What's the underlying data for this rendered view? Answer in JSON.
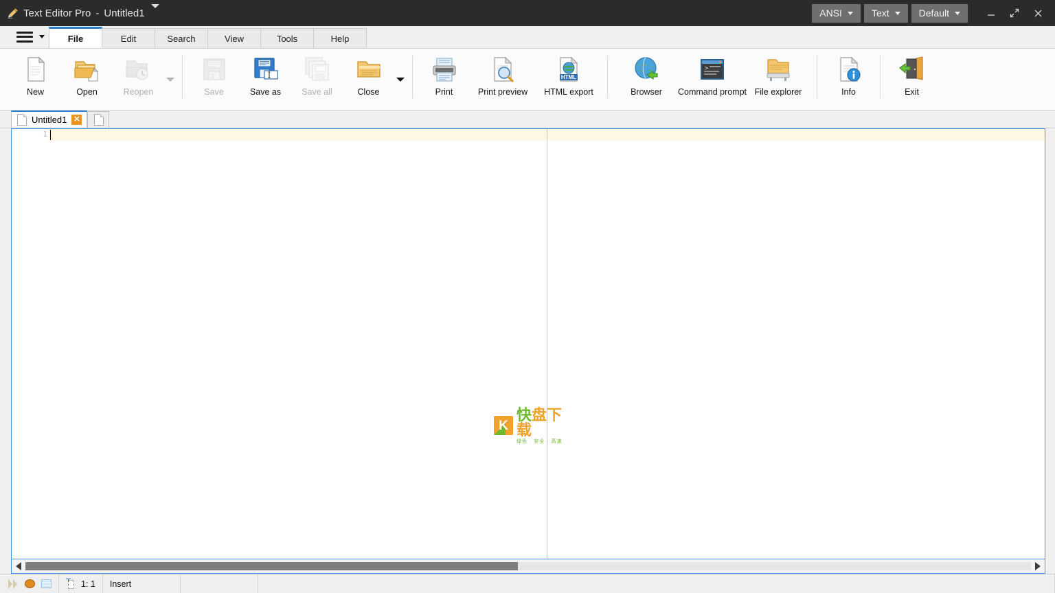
{
  "window": {
    "app_title": "Text Editor Pro",
    "separator": "-",
    "document_title": "Untitled1",
    "app_icon": "pencil-icon",
    "title_dropdown_icon": "chevron-down-icon",
    "encoding_button": "ANSI",
    "filetype_button": "Text",
    "scheme_button": "Default",
    "minimize_icon": "minimize-icon",
    "maximize_icon": "maximize-restore-icon",
    "close_icon": "close-icon",
    "titlebar_bg": "#2b2b2b",
    "accent": "#2b7fd4"
  },
  "menu": {
    "hamburger_icon": "hamburger-menu-icon",
    "hamburger_caret_icon": "chevron-down-icon",
    "tabs": [
      {
        "label": "File",
        "active": true
      },
      {
        "label": "Edit",
        "active": false
      },
      {
        "label": "Search",
        "active": false
      },
      {
        "label": "View",
        "active": false
      },
      {
        "label": "Tools",
        "active": false
      },
      {
        "label": "Help",
        "active": false
      }
    ]
  },
  "ribbon": {
    "groups": [
      {
        "name": "file-group",
        "buttons": [
          {
            "label": "New",
            "icon": "new-document-icon",
            "disabled": false,
            "dropdown": false
          },
          {
            "label": "Open",
            "icon": "open-folder-icon",
            "disabled": false,
            "dropdown": false
          },
          {
            "label": "Reopen",
            "icon": "reopen-recent-icon",
            "disabled": true,
            "dropdown": true
          }
        ]
      },
      {
        "name": "save-group",
        "buttons": [
          {
            "label": "Save",
            "icon": "save-floppy-icon",
            "disabled": true,
            "dropdown": false
          },
          {
            "label": "Save as",
            "icon": "save-as-floppy-icon",
            "disabled": false,
            "dropdown": false
          },
          {
            "label": "Save all",
            "icon": "save-all-floppy-icon",
            "disabled": true,
            "dropdown": false
          },
          {
            "label": "Close",
            "icon": "close-folder-icon",
            "disabled": false,
            "dropdown": true
          }
        ]
      },
      {
        "name": "print-group",
        "buttons": [
          {
            "label": "Print",
            "icon": "printer-icon",
            "disabled": false,
            "dropdown": false
          },
          {
            "label": "Print preview",
            "icon": "print-preview-icon",
            "disabled": false,
            "dropdown": false
          },
          {
            "label": "HTML export",
            "icon": "html-export-icon",
            "disabled": false,
            "dropdown": false
          }
        ]
      },
      {
        "name": "tools-group",
        "buttons": [
          {
            "label": "Browser",
            "icon": "browser-globe-icon",
            "disabled": false,
            "dropdown": false
          },
          {
            "label": "Command prompt",
            "icon": "command-prompt-icon",
            "disabled": false,
            "dropdown": false
          },
          {
            "label": "File explorer",
            "icon": "file-explorer-icon",
            "disabled": false,
            "dropdown": false
          }
        ]
      },
      {
        "name": "info-group",
        "buttons": [
          {
            "label": "Info",
            "icon": "info-document-icon",
            "disabled": false,
            "dropdown": false
          }
        ]
      },
      {
        "name": "exit-group",
        "buttons": [
          {
            "label": "Exit",
            "icon": "exit-door-icon",
            "disabled": false,
            "dropdown": false
          }
        ]
      }
    ]
  },
  "document_tabs": [
    {
      "label": "Untitled1",
      "icon": "document-icon",
      "close_icon": "close-tab-icon",
      "active": true
    }
  ],
  "editor": {
    "line_numbers": [
      "1"
    ],
    "content": "",
    "current_line_highlight": "#fdf7e3",
    "margin_guide_color": "#c6c6c6",
    "border_color": "#3e93e0",
    "watermark": {
      "logo_letter": "K",
      "text_chars": [
        "快",
        "盘",
        "下",
        "载"
      ],
      "subtitle": "绿色 · 安全 · 高速",
      "green": "#6eb92b",
      "orange": "#f0a32a"
    },
    "scrollbar": {
      "left_arrow_icon": "arrow-left-icon",
      "right_arrow_icon": "arrow-right-icon",
      "thumb_percent": 49
    }
  },
  "statusbar": {
    "icons": [
      "macro-play-icon",
      "macro-record-icon",
      "special-chars-icon"
    ],
    "caret_icon": "caret-position-icon",
    "position": "1: 1",
    "insert_mode": "Insert",
    "field_4": "",
    "field_5": ""
  }
}
